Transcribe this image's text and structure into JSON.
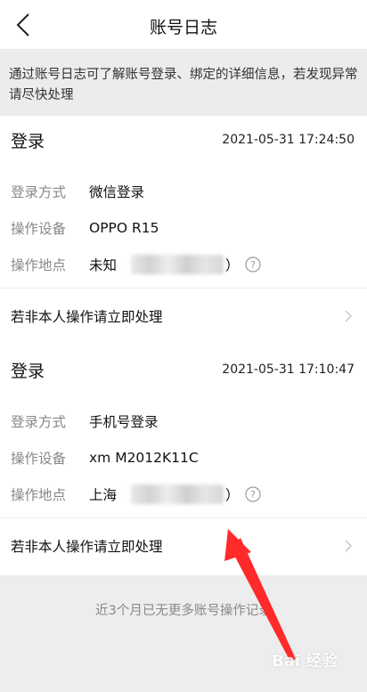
{
  "header": {
    "title": "账号日志"
  },
  "banner": {
    "text": "通过账号日志可了解账号登录、绑定的详细信息，若发现异常请尽快处理"
  },
  "records": [
    {
      "title": "登录",
      "time": "2021-05-31  17:24:50",
      "method_label": "登录方式",
      "method_value": "微信登录",
      "device_label": "操作设备",
      "device_value": "OPPO  R15",
      "location_label": "操作地点",
      "location_value": "未知",
      "location_suffix": "）",
      "action_label": "若非本人操作请立即处理"
    },
    {
      "title": "登录",
      "time": "2021-05-31  17:10:47",
      "method_label": "登录方式",
      "method_value": "手机号登录",
      "device_label": "操作设备",
      "device_value": "xm  M2012K11C",
      "location_label": "操作地点",
      "location_value": "上海",
      "location_suffix": "）",
      "action_label": "若非本人操作请立即处理"
    }
  ],
  "footer": {
    "note": "近3个月已无更多账号操作记录"
  },
  "colors": {
    "annotation_arrow": "#ff2a2a",
    "label_gray": "#888888",
    "background": "#ededed"
  },
  "icons": [
    "back-chevron-icon",
    "help-circle-icon",
    "chevron-right-icon"
  ]
}
